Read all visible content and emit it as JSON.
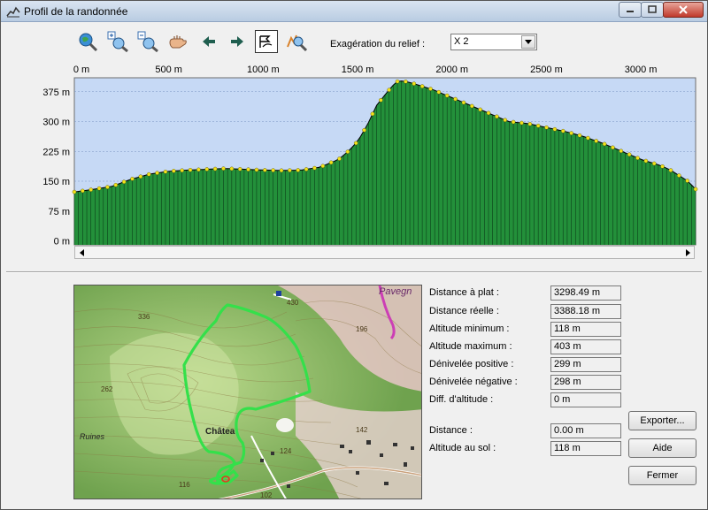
{
  "window": {
    "title": "Profil de la randonnée"
  },
  "toolbar": {
    "tools": [
      {
        "name": "zoom-full-icon"
      },
      {
        "name": "zoom-in-icon"
      },
      {
        "name": "zoom-out-icon"
      },
      {
        "name": "pan-hand-icon"
      },
      {
        "name": "back-arrow-icon"
      },
      {
        "name": "forward-arrow-icon"
      },
      {
        "name": "profile-mode-icon",
        "pressed": true
      },
      {
        "name": "zoom-profile-icon"
      }
    ],
    "relief_label": "Exagération du relief :",
    "relief_value": "X 2"
  },
  "chart_data": {
    "type": "area",
    "x_unit": "m",
    "y_unit": "m",
    "x_ticks": [
      "0 m",
      "500 m",
      "1000 m",
      "1500 m",
      "2000 m",
      "2500 m",
      "3000 m"
    ],
    "x_tick_values": [
      0,
      500,
      1000,
      1500,
      2000,
      2500,
      3000
    ],
    "y_ticks": [
      "0 m",
      "75 m",
      "150 m",
      "225 m",
      "300 m",
      "375 m"
    ],
    "y_tick_values": [
      0,
      75,
      150,
      225,
      300,
      375
    ],
    "xlim": [
      0,
      3290
    ],
    "ylim": [
      -10,
      410
    ],
    "grid": true,
    "colors": {
      "fill": "#23903a",
      "line": "#000000",
      "sky": "#c6d9f5",
      "point": "#f2e21a",
      "grid": "#7a95c4"
    },
    "series": [
      {
        "x": [
          0,
          80,
          200,
          300,
          400,
          500,
          600,
          700,
          800,
          900,
          1000,
          1100,
          1200,
          1300,
          1350,
          1400,
          1450,
          1500,
          1550,
          1600,
          1650,
          1700,
          1720,
          1760,
          1800,
          1900,
          2000,
          2100,
          2200,
          2300,
          2400,
          2500,
          2600,
          2700,
          2800,
          2900,
          3000,
          3100,
          3150,
          3200,
          3250,
          3290
        ],
        "y": [
          123,
          128,
          137,
          155,
          168,
          175,
          178,
          180,
          182,
          180,
          178,
          177,
          178,
          185,
          195,
          205,
          225,
          250,
          290,
          340,
          370,
          398,
          403,
          400,
          395,
          380,
          360,
          340,
          320,
          300,
          295,
          285,
          275,
          262,
          245,
          225,
          205,
          190,
          180,
          165,
          150,
          130
        ]
      }
    ]
  },
  "map": {
    "labels": [
      "336",
      "262",
      "Ruines",
      "Châtea",
      "430",
      "196",
      "142",
      "124",
      "116",
      "102",
      "Pavegn"
    ]
  },
  "stats": [
    {
      "label": "Distance à plat :",
      "value": "3298.49 m"
    },
    {
      "label": "Distance réelle :",
      "value": "3388.18 m"
    },
    {
      "label": "Altitude minimum :",
      "value": "118 m"
    },
    {
      "label": "Altitude maximum :",
      "value": "403 m"
    },
    {
      "label": "Dénivelée positive :",
      "value": "299 m"
    },
    {
      "label": "Dénivelée négative :",
      "value": "298 m"
    },
    {
      "label": "Diff. d'altitude :",
      "value": "0 m"
    }
  ],
  "cursor": {
    "distance_label": "Distance :",
    "distance_value": "0.00 m",
    "altitude_label": "Altitude au sol :",
    "altitude_value": "118 m"
  },
  "buttons": {
    "export": "Exporter...",
    "help": "Aide",
    "close": "Fermer"
  }
}
